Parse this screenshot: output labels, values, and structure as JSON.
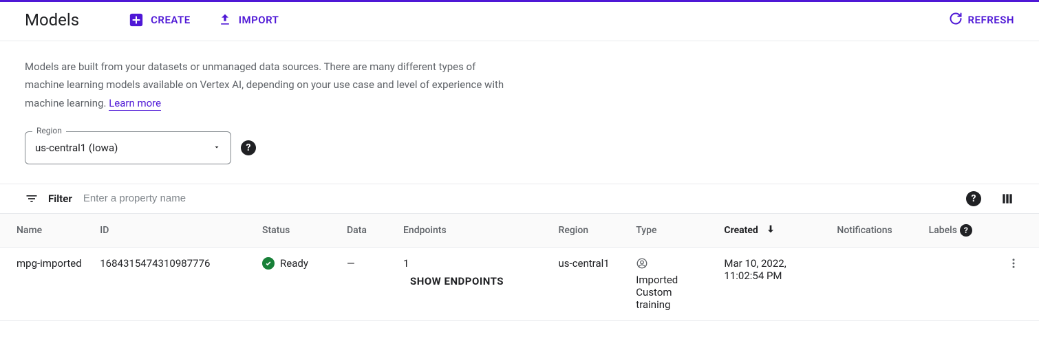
{
  "header": {
    "title": "Models",
    "create_label": "CREATE",
    "import_label": "IMPORT",
    "refresh_label": "REFRESH"
  },
  "description": {
    "text": "Models are built from your datasets or unmanaged data sources. There are many different types of machine learning models available on Vertex AI, depending on your use case and level of experience with machine learning.",
    "learn_more": "Learn more"
  },
  "region": {
    "label": "Region",
    "value": "us-central1 (Iowa)"
  },
  "filter": {
    "label": "Filter",
    "placeholder": "Enter a property name"
  },
  "columns": {
    "name": "Name",
    "id": "ID",
    "status": "Status",
    "data": "Data",
    "endpoints": "Endpoints",
    "region": "Region",
    "type": "Type",
    "created": "Created",
    "notifications": "Notifications",
    "labels": "Labels"
  },
  "rows": [
    {
      "name": "mpg-imported",
      "id": "1684315474310987776",
      "status": "Ready",
      "data": "—",
      "endpoints_count": "1",
      "show_endpoints": "SHOW ENDPOINTS",
      "region": "us-central1",
      "type": "Imported Custom training",
      "created": "Mar 10, 2022, 11:02:54 PM",
      "notifications": "",
      "labels": ""
    }
  ]
}
